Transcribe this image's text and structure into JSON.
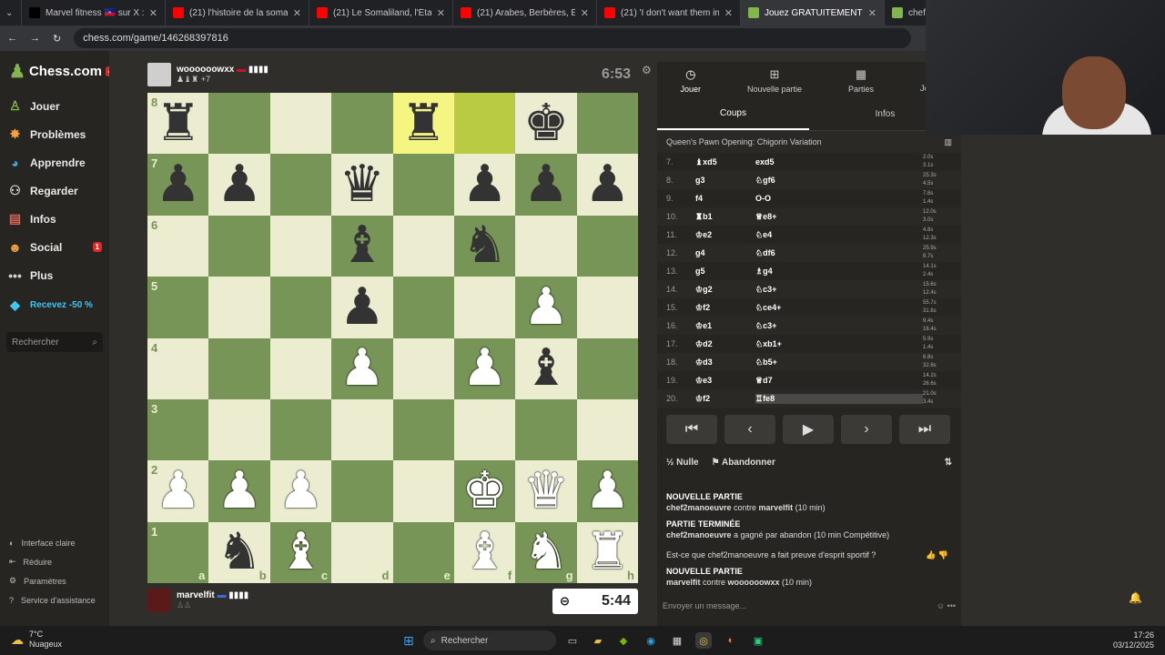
{
  "browser": {
    "tabs": [
      {
        "title": "Marvel fitness 🇭🇹 sur X : \"@8FM",
        "color": "#000000"
      },
      {
        "title": "(21) l'histoire de la somalie - Yo",
        "color": "#ff0000"
      },
      {
        "title": "(21) Le Somaliland, l'État qui n'",
        "color": "#ff0000"
      },
      {
        "title": "(21) Arabes, Berbères, Éthiopie",
        "color": "#ff0000"
      },
      {
        "title": "(21) 'I don't want them in our c",
        "color": "#ff0000"
      },
      {
        "title": "Jouez GRATUITEMENT aux",
        "color": "#81b64c"
      },
      {
        "title": "chef2",
        "color": "#81b64c"
      }
    ],
    "url": "chess.com/game/146268397816"
  },
  "sidebar": {
    "logo": "Chess.com",
    "logo_badge": "4",
    "items": [
      {
        "label": "Jouer",
        "icon": "pawn-icon",
        "glyph": "♙",
        "color": "#81b64c"
      },
      {
        "label": "Problèmes",
        "icon": "puzzle-icon",
        "glyph": "✸",
        "color": "#f7a23b"
      },
      {
        "label": "Apprendre",
        "icon": "learn-icon",
        "glyph": "◕",
        "color": "#41a4e5"
      },
      {
        "label": "Regarder",
        "icon": "binoculars-icon",
        "glyph": "⚇",
        "color": "#d0d0d0"
      },
      {
        "label": "Infos",
        "icon": "news-icon",
        "glyph": "▤",
        "color": "#e06050"
      },
      {
        "label": "Social",
        "icon": "social-icon",
        "glyph": "☻",
        "color": "#f7a23b",
        "badge": "1"
      },
      {
        "label": "Plus",
        "icon": "more-icon",
        "glyph": "•••",
        "color": "#d0d0d0"
      }
    ],
    "promo": "Recevez -50 %",
    "search_placeholder": "Rechercher",
    "footer": [
      {
        "label": "Interface claire",
        "icon": "theme-icon",
        "glyph": "◐"
      },
      {
        "label": "Réduire",
        "icon": "collapse-icon",
        "glyph": "⇤"
      },
      {
        "label": "Paramètres",
        "icon": "gear-icon",
        "glyph": "⚙"
      },
      {
        "label": "Service d'assistance",
        "icon": "help-icon",
        "glyph": "?"
      }
    ]
  },
  "game": {
    "top_player": {
      "name": "woooooowxx",
      "clock": "6:53",
      "captured": "+7"
    },
    "bottom_player": {
      "name": "marvelfit",
      "clock": "5:44"
    },
    "board": [
      [
        "r:b",
        "",
        "",
        "",
        "r:b",
        "",
        "k:b",
        ""
      ],
      [
        "p:b",
        "p:b",
        "",
        "q:b",
        "",
        "p:b",
        "p:b",
        "p:b"
      ],
      [
        "",
        "",
        "",
        "b:b",
        "",
        "n:b",
        "",
        ""
      ],
      [
        "",
        "",
        "",
        "p:b",
        "",
        "",
        "P:w",
        ""
      ],
      [
        "",
        "",
        "",
        "P:w",
        "",
        "P:w",
        "b:b",
        ""
      ],
      [
        "",
        "",
        "",
        "",
        "",
        "",
        "",
        ""
      ],
      [
        "P:w",
        "P:w",
        "P:w",
        "",
        "",
        "K:w",
        "Q:w",
        "P:w"
      ],
      [
        "",
        "n:b",
        "B:w",
        "",
        "",
        "B:w",
        "N:w",
        "R:w"
      ]
    ],
    "highlight": [
      [
        0,
        4
      ],
      [
        0,
        5
      ]
    ],
    "ranks": [
      "8",
      "7",
      "6",
      "5",
      "4",
      "3",
      "2",
      "1"
    ],
    "files": [
      "a",
      "b",
      "c",
      "d",
      "e",
      "f",
      "g",
      "h"
    ]
  },
  "panel": {
    "tabs": [
      {
        "label": "Jouer",
        "icon": "clock-icon",
        "glyph": "◷"
      },
      {
        "label": "Nouvelle partie",
        "icon": "plus-icon",
        "glyph": "⊞"
      },
      {
        "label": "Parties",
        "icon": "board-icon",
        "glyph": "▦"
      },
      {
        "label": "Joue",
        "icon": "user-icon",
        "glyph": "☺"
      }
    ],
    "subtabs": [
      "Coups",
      "Infos"
    ],
    "opening": "Queen's Pawn Opening: Chigorin Variation",
    "moves": [
      {
        "n": "7.",
        "w": "♝xd5",
        "b": "exd5",
        "tw": "2.0s",
        "tb": "3.1s"
      },
      {
        "n": "8.",
        "w": "g3",
        "b": "♘gf6",
        "tw": "25.3s",
        "tb": "4.5s"
      },
      {
        "n": "9.",
        "w": "f4",
        "b": "O-O",
        "tw": "7.8s",
        "tb": "1.4s"
      },
      {
        "n": "10.",
        "w": "♜b1",
        "b": "♕e8+",
        "tw": "12.0s",
        "tb": "3.0s"
      },
      {
        "n": "11.",
        "w": "♔e2",
        "b": "♘e4",
        "tw": "4.8s",
        "tb": "12.3s"
      },
      {
        "n": "12.",
        "w": "g4",
        "b": "♘df6",
        "tw": "25.9s",
        "tb": "8.7s"
      },
      {
        "n": "13.",
        "w": "g5",
        "b": "♗g4",
        "tw": "14.1s",
        "tb": "2.4s"
      },
      {
        "n": "14.",
        "w": "♔g2",
        "b": "♘c3+",
        "tw": "15.6s",
        "tb": "12.4s"
      },
      {
        "n": "15.",
        "w": "♔f2",
        "b": "♘ce4+",
        "tw": "55.7s",
        "tb": "31.6s"
      },
      {
        "n": "16.",
        "w": "♔e1",
        "b": "♘c3+",
        "tw": "9.4s",
        "tb": "16.4s"
      },
      {
        "n": "17.",
        "w": "♔d2",
        "b": "♘xb1+",
        "tw": "5.9s",
        "tb": "1.4s"
      },
      {
        "n": "18.",
        "w": "♔d3",
        "b": "♘b5+",
        "tw": "6.8s",
        "tb": "32.6s"
      },
      {
        "n": "19.",
        "w": "♔e3",
        "b": "♕d7",
        "tw": "14.2s",
        "tb": "26.6s"
      },
      {
        "n": "20.",
        "w": "♔f2",
        "b": "♖fe8",
        "tw": "21.0s",
        "tb": "3.4s"
      }
    ],
    "nav": [
      "⏮",
      "‹",
      "▶",
      "›",
      "⏭"
    ],
    "draw_label": "Nulle",
    "resign_label": "Abandonner",
    "chat": [
      {
        "head": "NOUVELLE PARTIE",
        "line1": "chef2manoeuvre",
        "mid": " contre ",
        "line2": "marvelfit",
        "tail": " (10 min)"
      },
      {
        "head": "PARTIE TERMINÉE",
        "line1": "chef2manoeuvre",
        "mid": " a gagné par abandon ",
        "line2": "",
        "tail": "(10 min Compétitive)"
      }
    ],
    "sportsmanship": "Est-ce que chef2manoeuvre a fait preuve d'esprit sportif ?",
    "chat2": {
      "head": "NOUVELLE PARTIE",
      "line1": "marvelfit",
      "mid": " contre ",
      "line2": "woooooowxx",
      "tail": " (10 min)"
    },
    "message_placeholder": "Envoyer un message..."
  },
  "taskbar": {
    "temp": "7°C",
    "weather": "Nuageux",
    "search": "Rechercher",
    "time": "17:26",
    "date": "03/12/2025"
  }
}
